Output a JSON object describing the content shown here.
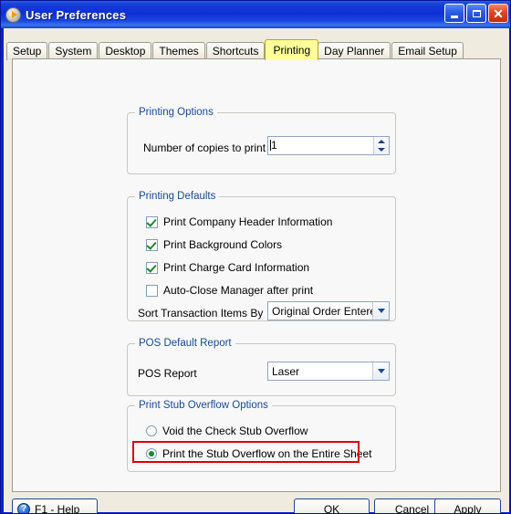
{
  "window": {
    "title": "User Preferences",
    "icon": "play-circle-icon",
    "controls": {
      "minimize": "–",
      "maximize": "□",
      "close": "✕"
    }
  },
  "tabs": [
    {
      "label": "Setup",
      "selected": false
    },
    {
      "label": "System",
      "selected": false
    },
    {
      "label": "Desktop",
      "selected": false
    },
    {
      "label": "Themes",
      "selected": false
    },
    {
      "label": "Shortcuts",
      "selected": false
    },
    {
      "label": "Printing",
      "selected": true
    },
    {
      "label": "Day Planner",
      "selected": false
    },
    {
      "label": "Email Setup",
      "selected": false
    }
  ],
  "groups": {
    "printing_options": {
      "legend": "Printing Options",
      "copies_label": "Number of copies to print",
      "copies_value": "1"
    },
    "printing_defaults": {
      "legend": "Printing Defaults",
      "checkboxes": [
        {
          "label": "Print Company Header Information",
          "checked": true
        },
        {
          "label": "Print Background Colors",
          "checked": true
        },
        {
          "label": "Print Charge Card Information",
          "checked": true
        },
        {
          "label": "Auto-Close Manager after print",
          "checked": false
        }
      ],
      "sort_label": "Sort Transaction Items By",
      "sort_value": "Original Order Entered"
    },
    "pos_default_report": {
      "legend": "POS Default Report",
      "report_label": "POS Report",
      "report_value": "Laser"
    },
    "print_stub_overflow": {
      "legend": "Print Stub Overflow Options",
      "radios": [
        {
          "label": "Void the Check Stub Overflow",
          "selected": false
        },
        {
          "label": "Print the Stub Overflow on the Entire Sheet",
          "selected": true
        }
      ]
    }
  },
  "footer": {
    "help_label": "F1 - Help",
    "help_icon_glyph": "?",
    "ok_label": "OK",
    "cancel_label": "Cancel",
    "apply_label": "Apply"
  },
  "annotations": {
    "tab_highlight_color": "#FFFF99",
    "red_box_color": "#E00000"
  },
  "colors": {
    "titlebar_blue": "#1438D8",
    "window_frame": "#0A1FD0",
    "dialog_face": "#EFEBDE",
    "panel": "#F8F8F8",
    "legend_blue": "#16499D",
    "check_green": "#188A2C"
  }
}
